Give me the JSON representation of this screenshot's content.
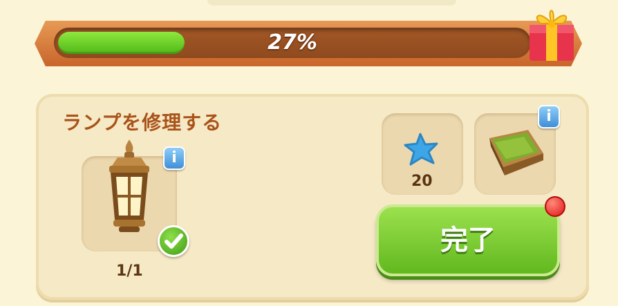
{
  "progress": {
    "label": "27%",
    "fraction": 0.27
  },
  "task": {
    "title": "ランプを修理する",
    "item_count": "1/1"
  },
  "materials": [
    {
      "name": "star-material",
      "count": "20"
    },
    {
      "name": "box-material"
    }
  ],
  "info_label": "i",
  "done_button": {
    "label": "完了"
  },
  "colors": {
    "background": "#fbf4d6",
    "progress_fill": "#5cc41f",
    "title": "#a9531b",
    "button": "#7ccc35"
  }
}
